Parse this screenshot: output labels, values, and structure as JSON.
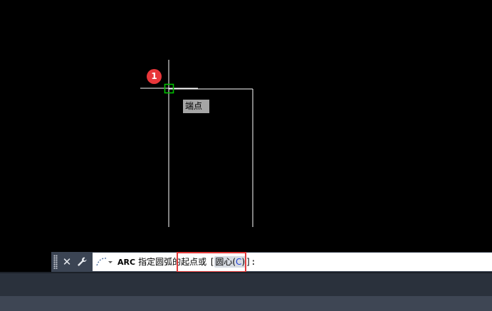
{
  "canvas": {
    "background": "#000000",
    "snap_tooltip": "端点",
    "step_badge": "1",
    "snap_marker_color": "#00c000",
    "line_color": "#ffffff"
  },
  "command_line": {
    "close_icon": "close-icon",
    "customize_icon": "wrench-icon",
    "recent_commands_icon": "recent-commands-icon",
    "command_name": "ARC",
    "prompt": "指定圆弧的起点或",
    "options_open": "[",
    "option_label": "圆心(",
    "option_key": "C",
    "option_close": ")",
    "options_end": "]:",
    "highlight_color": "#e23b3b"
  }
}
